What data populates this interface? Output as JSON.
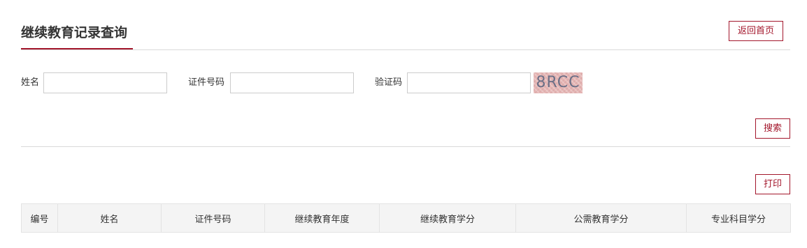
{
  "page": {
    "title": "继续教育记录查询",
    "home_button": "返回首页"
  },
  "form": {
    "name_label": "姓名",
    "name_value": "",
    "id_label": "证件号码",
    "id_value": "",
    "captcha_label": "验证码",
    "captcha_value": "",
    "captcha_text": "8RCC",
    "search_button": "搜索"
  },
  "results": {
    "print_button": "打印",
    "columns": [
      "编号",
      "姓名",
      "证件号码",
      "继续教育年度",
      "继续教育学分",
      "公需教育学分",
      "专业科目学分"
    ],
    "rows": []
  },
  "colors": {
    "accent": "#a3162b",
    "table_header_bg": "#f4f4f4",
    "border": "#d9d9d9"
  }
}
